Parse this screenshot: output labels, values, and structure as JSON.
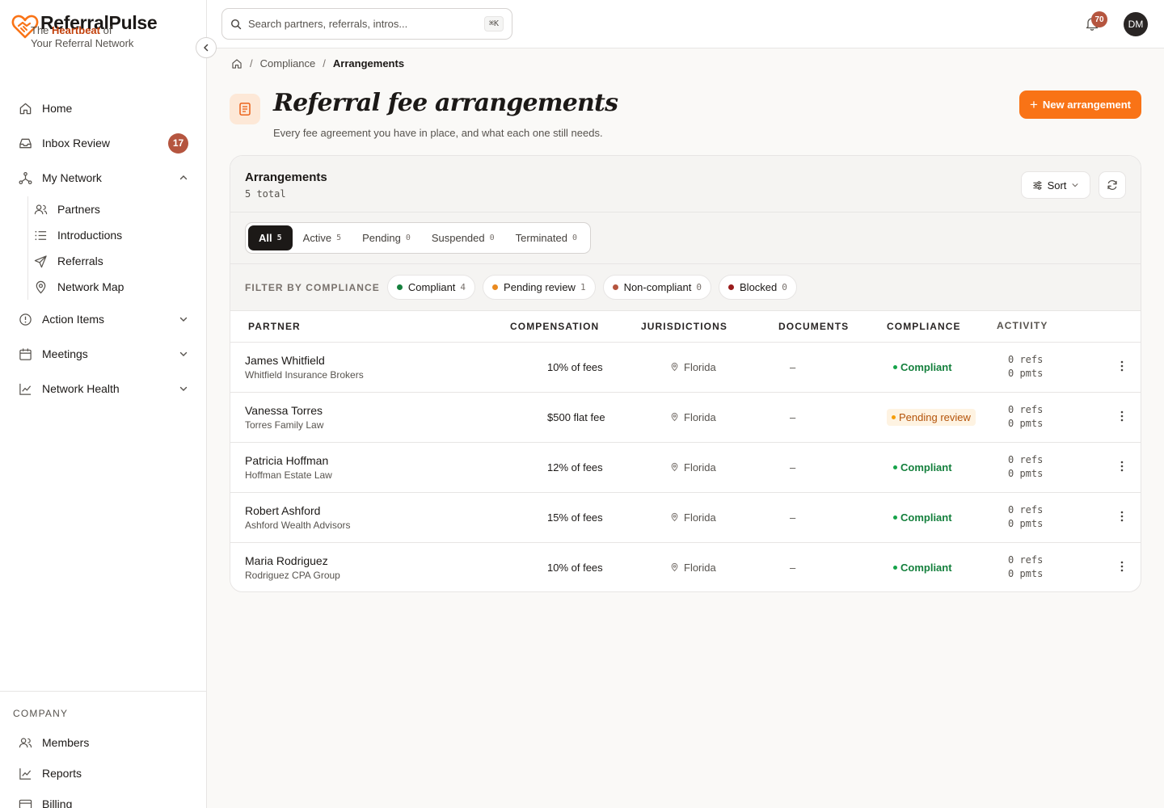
{
  "brand": {
    "name": "ReferralPulse",
    "tag_pre": "The ",
    "tag_hl": "Heartbeat",
    "tag_mid": " of",
    "tag_post": "Your Referral Network",
    "color": "#f97316"
  },
  "nav": {
    "home": "Home",
    "inbox": "Inbox Review",
    "inbox_badge": "17",
    "network": "My Network",
    "network_sub": [
      "Partners",
      "Introductions",
      "Referrals",
      "Network Map"
    ],
    "action": "Action Items",
    "meetings": "Meetings",
    "health": "Network Health"
  },
  "company": {
    "heading": "COMPANY",
    "items": [
      "Members",
      "Reports",
      "Billing"
    ]
  },
  "topbar": {
    "search_placeholder": "Search partners, referrals, intros...",
    "shortcut": "⌘K",
    "notifications": "70",
    "avatar": "DM"
  },
  "breadcrumb": {
    "items": [
      "Compliance",
      "Arrangements"
    ]
  },
  "page": {
    "title": "Referral fee arrangements",
    "subtitle": "Every fee agreement you have in place, and what each one still needs.",
    "new_button": "New arrangement"
  },
  "card": {
    "title": "Arrangements",
    "count": "5 total",
    "sort": "Sort"
  },
  "tabs": [
    {
      "label": "All",
      "count": "5"
    },
    {
      "label": "Active",
      "count": "5"
    },
    {
      "label": "Pending",
      "count": "0"
    },
    {
      "label": "Suspended",
      "count": "0"
    },
    {
      "label": "Terminated",
      "count": "0"
    }
  ],
  "filters": {
    "label": "FILTER BY COMPLIANCE",
    "chips": [
      {
        "label": "Compliant",
        "count": "4",
        "color": "#15803d"
      },
      {
        "label": "Pending review",
        "count": "1",
        "color": "#ea8a1f"
      },
      {
        "label": "Non-compliant",
        "count": "0",
        "color": "#b5553f"
      },
      {
        "label": "Blocked",
        "count": "0",
        "color": "#991b1b"
      }
    ]
  },
  "table": {
    "headers": [
      "PARTNER",
      "COMPENSATION",
      "JURISDICTIONS",
      "DOCUMENTS",
      "COMPLIANCE",
      "ACTIVITY"
    ],
    "rows": [
      {
        "name": "James Whitfield",
        "firm": "Whitfield Insurance Brokers",
        "comp": "10% of fees",
        "jur": "Florida",
        "docs": "–",
        "status": "Compliant",
        "refs": "0 refs",
        "pmts": "0 pmts"
      },
      {
        "name": "Vanessa Torres",
        "firm": "Torres Family Law",
        "comp": "$500 flat fee",
        "jur": "Florida",
        "docs": "–",
        "status": "Pending review",
        "refs": "0 refs",
        "pmts": "0 pmts"
      },
      {
        "name": "Patricia Hoffman",
        "firm": "Hoffman Estate Law",
        "comp": "12% of fees",
        "jur": "Florida",
        "docs": "–",
        "status": "Compliant",
        "refs": "0 refs",
        "pmts": "0 pmts"
      },
      {
        "name": "Robert Ashford",
        "firm": "Ashford Wealth Advisors",
        "comp": "15% of fees",
        "jur": "Florida",
        "docs": "–",
        "status": "Compliant",
        "refs": "0 refs",
        "pmts": "0 pmts"
      },
      {
        "name": "Maria Rodriguez",
        "firm": "Rodriguez CPA Group",
        "comp": "10% of fees",
        "jur": "Florida",
        "docs": "–",
        "status": "Compliant",
        "refs": "0 refs",
        "pmts": "0 pmts"
      }
    ]
  }
}
